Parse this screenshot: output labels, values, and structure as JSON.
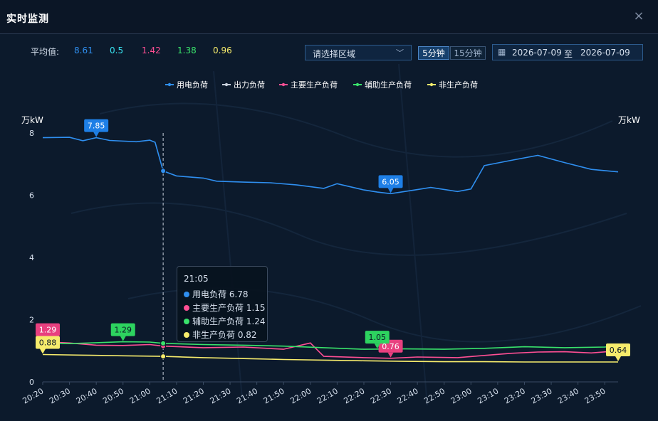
{
  "header": {
    "title": "实时监测",
    "close_icon": "close-icon"
  },
  "averages": {
    "label": "平均值:",
    "values": [
      {
        "text": "8.61",
        "color": "#2f8ff0"
      },
      {
        "text": "0.5",
        "color": "#38e3f0"
      },
      {
        "text": "1.42",
        "color": "#ff4f94"
      },
      {
        "text": "1.38",
        "color": "#39e36b"
      },
      {
        "text": "0.96",
        "color": "#f7ec6c"
      }
    ]
  },
  "controls": {
    "region_placeholder": "请选择区域",
    "interval_5": "5分钟",
    "interval_15": "15分钟",
    "selected_interval": "5分钟",
    "date_start": "2026-07-09",
    "date_sep": "至",
    "date_end": "2026-07-09"
  },
  "chart_data": {
    "type": "line",
    "ylabel_left": "万kW",
    "ylabel_right": "万kW",
    "ylim": [
      0,
      8
    ],
    "yticks": [
      "0",
      "2",
      "4",
      "6",
      "8"
    ],
    "x_range": [
      "20:20",
      "23:55"
    ],
    "xtick_labels": [
      "20:20",
      "20:30",
      "20:40",
      "20:50",
      "21:00",
      "21:10",
      "21:20",
      "21:30",
      "21:40",
      "21:50",
      "22:00",
      "22:10",
      "22:20",
      "22:30",
      "22:40",
      "22:50",
      "23:00",
      "23:10",
      "23:20",
      "23:30",
      "23:40",
      "23:50"
    ],
    "legend": [
      {
        "name": "用电负荷",
        "color": "#2f8ff0"
      },
      {
        "name": "出力负荷",
        "color": "#c9d1dd"
      },
      {
        "name": "主要生产负荷",
        "color": "#ff4f94"
      },
      {
        "name": "辅助生产负荷",
        "color": "#39e36b"
      },
      {
        "name": "非生产负荷",
        "color": "#f7ec6c"
      }
    ],
    "series": [
      {
        "name": "用电负荷",
        "color": "#2f8ff0",
        "points": [
          [
            "20:20",
            7.85
          ],
          [
            "20:30",
            7.86
          ],
          [
            "20:35",
            7.75
          ],
          [
            "20:40",
            7.85
          ],
          [
            "20:45",
            7.76
          ],
          [
            "20:55",
            7.72
          ],
          [
            "21:00",
            7.77
          ],
          [
            "21:02",
            7.7
          ],
          [
            "21:05",
            6.78
          ],
          [
            "21:10",
            6.62
          ],
          [
            "21:20",
            6.55
          ],
          [
            "21:25",
            6.45
          ],
          [
            "21:35",
            6.42
          ],
          [
            "21:45",
            6.4
          ],
          [
            "21:55",
            6.33
          ],
          [
            "22:05",
            6.22
          ],
          [
            "22:10",
            6.37
          ],
          [
            "22:20",
            6.17
          ],
          [
            "22:25",
            6.1
          ],
          [
            "22:30",
            6.05
          ],
          [
            "22:40",
            6.18
          ],
          [
            "22:45",
            6.25
          ],
          [
            "22:55",
            6.12
          ],
          [
            "23:00",
            6.2
          ],
          [
            "23:05",
            6.95
          ],
          [
            "23:15",
            7.12
          ],
          [
            "23:25",
            7.28
          ],
          [
            "23:35",
            7.05
          ],
          [
            "23:45",
            6.83
          ],
          [
            "23:55",
            6.75
          ]
        ]
      },
      {
        "name": "主要生产负荷",
        "color": "#ff4f94",
        "points": [
          [
            "20:20",
            1.29
          ],
          [
            "20:30",
            1.25
          ],
          [
            "20:40",
            1.18
          ],
          [
            "20:50",
            1.17
          ],
          [
            "21:00",
            1.2
          ],
          [
            "21:05",
            1.15
          ],
          [
            "21:20",
            1.1
          ],
          [
            "21:35",
            1.12
          ],
          [
            "21:50",
            1.05
          ],
          [
            "22:00",
            1.25
          ],
          [
            "22:05",
            0.82
          ],
          [
            "22:20",
            0.78
          ],
          [
            "22:30",
            0.76
          ],
          [
            "22:40",
            0.8
          ],
          [
            "22:55",
            0.78
          ],
          [
            "23:05",
            0.85
          ],
          [
            "23:15",
            0.92
          ],
          [
            "23:25",
            0.96
          ],
          [
            "23:35",
            0.97
          ],
          [
            "23:45",
            0.93
          ],
          [
            "23:55",
            1.0
          ]
        ]
      },
      {
        "name": "辅助生产负荷",
        "color": "#39e36b",
        "points": [
          [
            "20:20",
            1.25
          ],
          [
            "20:30",
            1.23
          ],
          [
            "20:40",
            1.26
          ],
          [
            "20:50",
            1.29
          ],
          [
            "21:00",
            1.28
          ],
          [
            "21:05",
            1.24
          ],
          [
            "21:20",
            1.2
          ],
          [
            "21:35",
            1.18
          ],
          [
            "21:50",
            1.15
          ],
          [
            "22:05",
            1.1
          ],
          [
            "22:20",
            1.05
          ],
          [
            "22:35",
            1.06
          ],
          [
            "22:50",
            1.05
          ],
          [
            "23:05",
            1.08
          ],
          [
            "23:20",
            1.13
          ],
          [
            "23:35",
            1.1
          ],
          [
            "23:50",
            1.12
          ],
          [
            "23:55",
            1.15
          ]
        ]
      },
      {
        "name": "非生产负荷",
        "color": "#f7ec6c",
        "points": [
          [
            "20:20",
            0.88
          ],
          [
            "20:35",
            0.86
          ],
          [
            "20:50",
            0.84
          ],
          [
            "21:05",
            0.82
          ],
          [
            "21:20",
            0.78
          ],
          [
            "21:35",
            0.75
          ],
          [
            "21:50",
            0.72
          ],
          [
            "22:05",
            0.7
          ],
          [
            "22:20",
            0.68
          ],
          [
            "22:35",
            0.66
          ],
          [
            "22:50",
            0.65
          ],
          [
            "23:05",
            0.65
          ],
          [
            "23:20",
            0.64
          ],
          [
            "23:35",
            0.64
          ],
          [
            "23:55",
            0.64
          ]
        ]
      }
    ],
    "markers": [
      {
        "text": "7.85",
        "series": "用电负荷",
        "x": "20:40",
        "y": 7.85,
        "color": "#1e7fe6",
        "text_color": "#ffffff"
      },
      {
        "text": "6.05",
        "series": "用电负荷",
        "x": "22:30",
        "y": 6.05,
        "color": "#1e7fe6",
        "text_color": "#ffffff"
      },
      {
        "text": "1.29",
        "series": "主要生产负荷",
        "x": "20:20",
        "y": 1.29,
        "color": "#e8407f",
        "text_color": "#ffffff"
      },
      {
        "text": "0.76",
        "series": "主要生产负荷",
        "x": "22:30",
        "y": 0.76,
        "color": "#e8407f",
        "text_color": "#ffffff"
      },
      {
        "text": "1.29",
        "series": "辅助生产负荷",
        "x": "20:50",
        "y": 1.29,
        "color": "#2dd35f",
        "text_color": "#0b1626"
      },
      {
        "text": "1.05",
        "series": "辅助生产负荷",
        "x": "22:25",
        "y": 1.05,
        "color": "#2dd35f",
        "text_color": "#0b1626"
      },
      {
        "text": "0.88",
        "series": "非生产负荷",
        "x": "20:20",
        "y": 0.88,
        "color": "#f7ec6c",
        "text_color": "#0b1626"
      },
      {
        "text": "0.64",
        "series": "非生产负荷",
        "x": "23:55",
        "y": 0.64,
        "color": "#f7ec6c",
        "text_color": "#0b1626"
      }
    ],
    "crosshair_x": "21:05",
    "tooltip": {
      "time": "21:05",
      "rows": [
        {
          "label": "用电负荷 6.78",
          "color": "#2f8ff0"
        },
        {
          "label": "主要生产负荷 1.15",
          "color": "#ff4f94"
        },
        {
          "label": "辅助生产负荷 1.24",
          "color": "#39e36b"
        },
        {
          "label": "非生产负荷 0.82",
          "color": "#f7ec6c"
        }
      ]
    }
  }
}
